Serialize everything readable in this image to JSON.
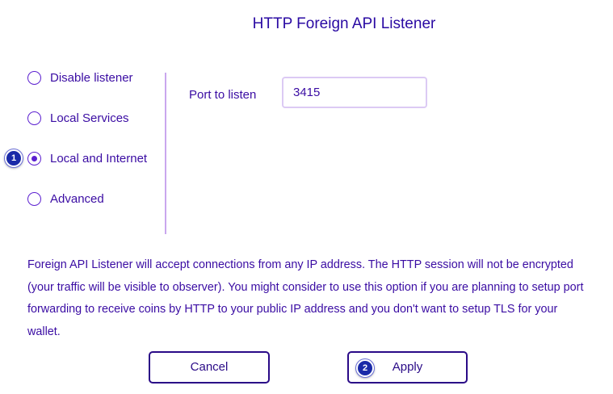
{
  "dialog": {
    "title": "HTTP Foreign API Listener"
  },
  "listener_options": [
    {
      "label": "Disable listener",
      "checked": false
    },
    {
      "label": "Local Services",
      "checked": false
    },
    {
      "label": "Local and Internet",
      "checked": true
    },
    {
      "label": "Advanced",
      "checked": false
    }
  ],
  "port": {
    "label": "Port to listen",
    "value": "3415"
  },
  "description": "Foreign API Listener will accept connections from any IP address. The HTTP session will not be encrypted (your traffic will be visible to observer). You might consider to use this option if you are planning to setup port forwarding to receive coins by HTTP to your public IP address and you don't want to setup TLS for your wallet.",
  "buttons": {
    "cancel_label": "Cancel",
    "apply_label": "Apply"
  },
  "step_markers": [
    "1",
    "2"
  ]
}
